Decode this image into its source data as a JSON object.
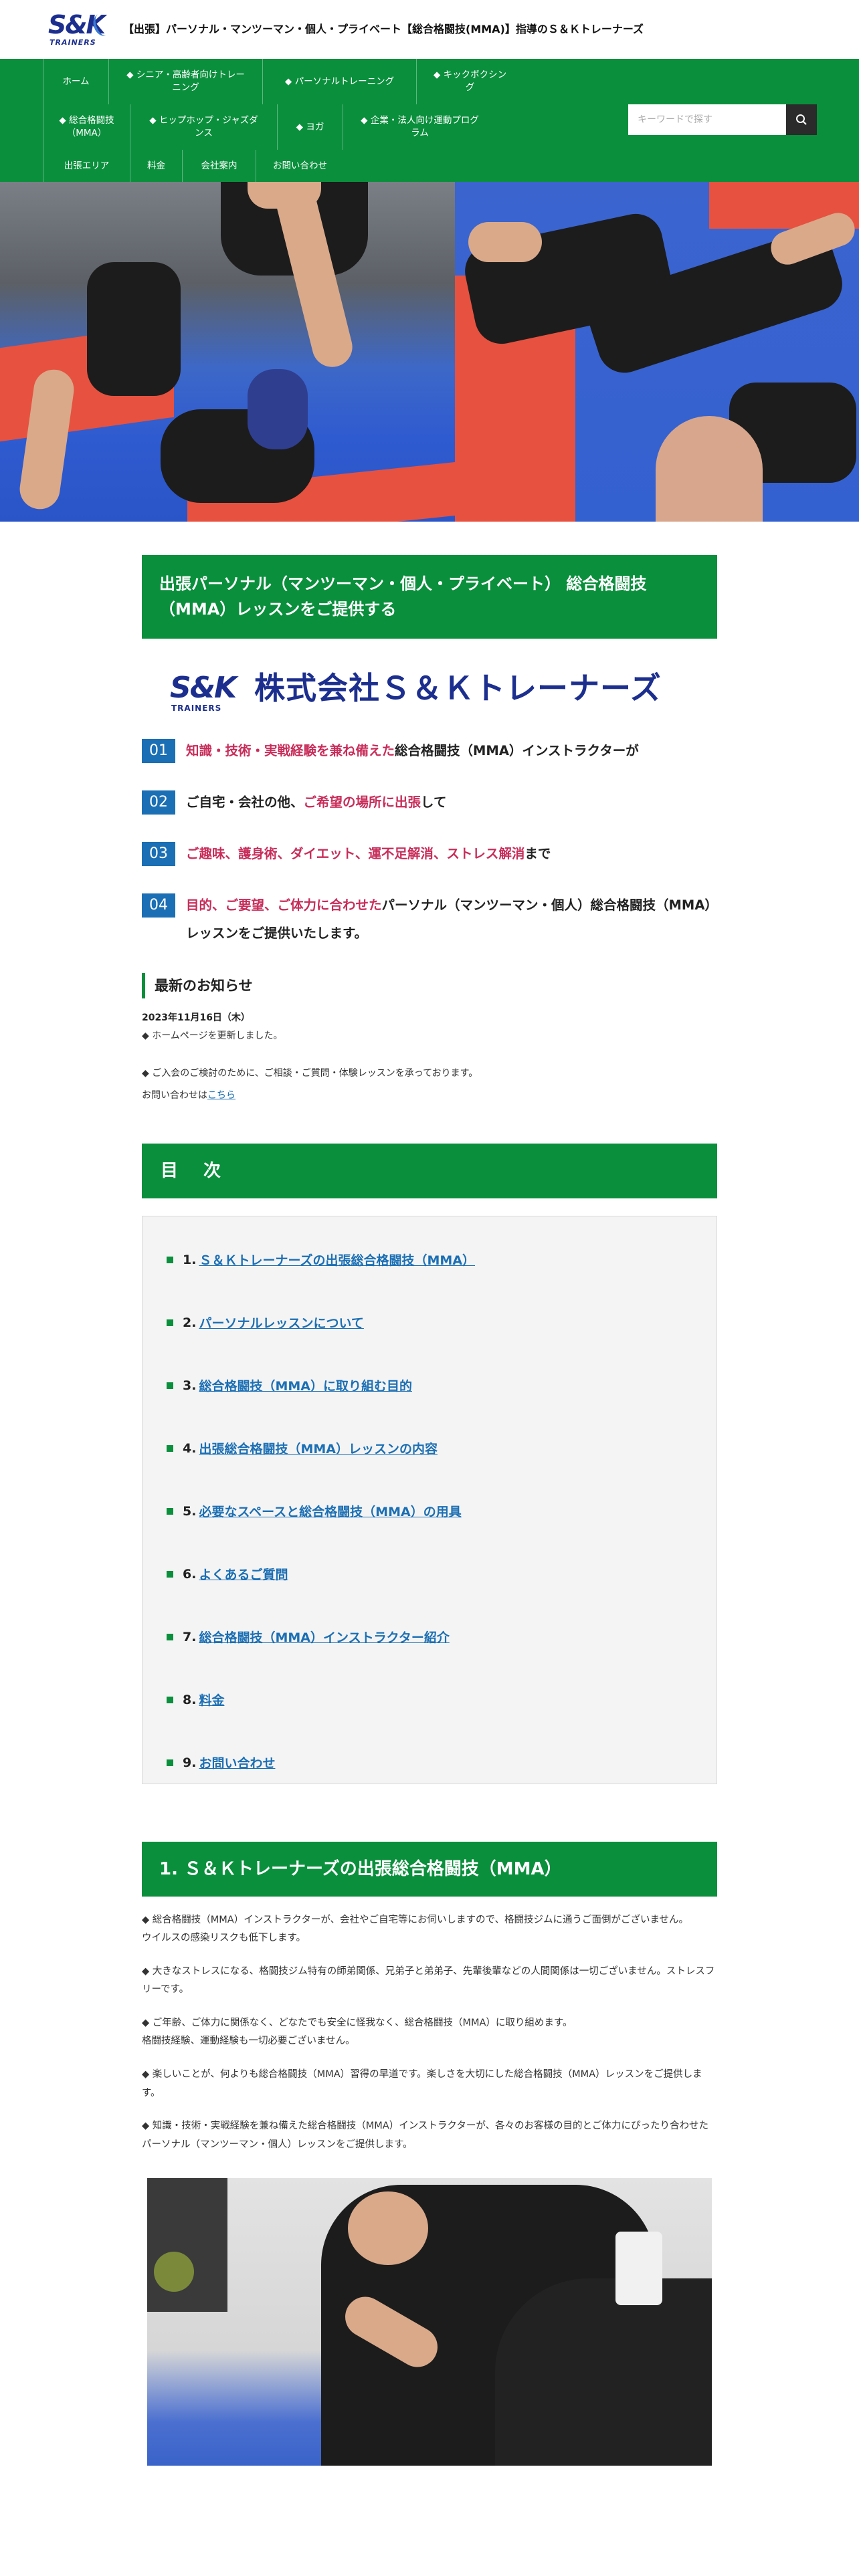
{
  "header": {
    "logo_text": "S&K",
    "logo_sub": "TRAINERS",
    "site_title": "【出張】パーソナル・マンツーマン・個人・プライベート【総合格闘技(MMA)】指導のＳ＆Ｋトレーナーズ"
  },
  "nav": {
    "row1": [
      "ホーム",
      "◆ シニア・高齢者向けトレーニング",
      "◆ パーソナルトレーニング",
      "◆ キックボクシング"
    ],
    "row2": [
      "◆ 総合格闘技（MMA）",
      "◆ ヒップホップ・ジャズダンス",
      "◆ ヨガ",
      "◆ 企業・法人向け運動プログラム"
    ],
    "row3": [
      "出張エリア",
      "料金",
      "会社案内",
      "お問い合わせ"
    ],
    "search_placeholder": "キーワードで探す"
  },
  "intro": {
    "heading": "出張パーソナル（マンツーマン・個人・プライベート） 総合格闘技（MMA）レッスンをご提供する",
    "company_mark": "S&K",
    "company_mark_sub": "TRAINERS",
    "company_name": "株式会社Ｓ＆Ｋトレーナーズ"
  },
  "points": [
    {
      "num": "01",
      "em": "知識・技術・実戦経験を兼ね備えた",
      "rest": "総合格闘技（MMA）インストラクターが"
    },
    {
      "num": "02",
      "pre": "ご自宅・会社の他、",
      "em": "ご希望の場所に出張",
      "rest": "して"
    },
    {
      "num": "03",
      "em": "ご趣味、護身術、ダイエット、運不足解消、ストレス解消",
      "rest": "まで"
    },
    {
      "num": "04",
      "em": "目的、ご要望、ご体力に合わせた",
      "rest": "パーソナル（マンツーマン・個人）総合格闘技（MMA）レッスンをご提供いたします。"
    }
  ],
  "news": {
    "heading": "最新のお知らせ",
    "date": "2023年11月16日（木）",
    "line1": "◆ ホームページを更新しました。",
    "line2": "◆ ご入会のご検討のために、ご相談・ご質問・体験レッスンを承っております。",
    "line3_pre": "お問い合わせは",
    "line3_link": "こちら"
  },
  "toc": {
    "heading": "目　次",
    "items": [
      {
        "n": "1.",
        "label": "Ｓ＆Ｋトレーナーズの出張総合格闘技（MMA）"
      },
      {
        "n": "2.",
        "label": "パーソナルレッスンについて"
      },
      {
        "n": "3.",
        "label": "総合格闘技（MMA）に取り組む目的"
      },
      {
        "n": "4.",
        "label": "出張総合格闘技（MMA）レッスンの内容"
      },
      {
        "n": "5.",
        "label": "必要なスペースと総合格闘技（MMA）の用具"
      },
      {
        "n": "6.",
        "label": "よくあるご質問"
      },
      {
        "n": "7.",
        "label": "総合格闘技（MMA）インストラクター紹介"
      },
      {
        "n": "8.",
        "label": "料金"
      },
      {
        "n": "9.",
        "label": "お問い合わせ"
      }
    ]
  },
  "section1": {
    "heading": "1. Ｓ＆Ｋトレーナーズの出張総合格闘技（MMA）",
    "p1": "◆ 総合格闘技（MMA）インストラクターが、会社やご自宅等にお伺いしますので、格闘技ジムに通うご面倒がございません。",
    "p1b": "ウイルスの感染リスクも低下します。",
    "p2": "◆ 大きなストレスになる、格闘技ジム特有の師弟関係、兄弟子と弟弟子、先輩後輩などの人間関係は一切ございません。ストレスフリーです。",
    "p3": "◆ ご年齢、ご体力に関係なく、どなたでも安全に怪我なく、総合格闘技（MMA）に取り組めます。",
    "p3b": "格闘技経験、運動経験も一切必要ございません。",
    "p4": "◆ 楽しいことが、何よりも総合格闘技（MMA）習得の早道です。楽しさを大切にした総合格闘技（MMA）レッスンをご提供します。",
    "p5": "◆ 知識・技術・実戦経験を兼ね備えた総合格闘技（MMA）インストラクターが、各々のお客様の目的とご体力にぴったり合わせたパーソナル（マンツーマン・個人）レッスンをご提供します。"
  },
  "colors": {
    "brand_green": "#0a8f3c",
    "number_blue": "#1b6fb4",
    "emphasis_red": "#c82d5a",
    "logo_navy": "#1c2f8f"
  }
}
